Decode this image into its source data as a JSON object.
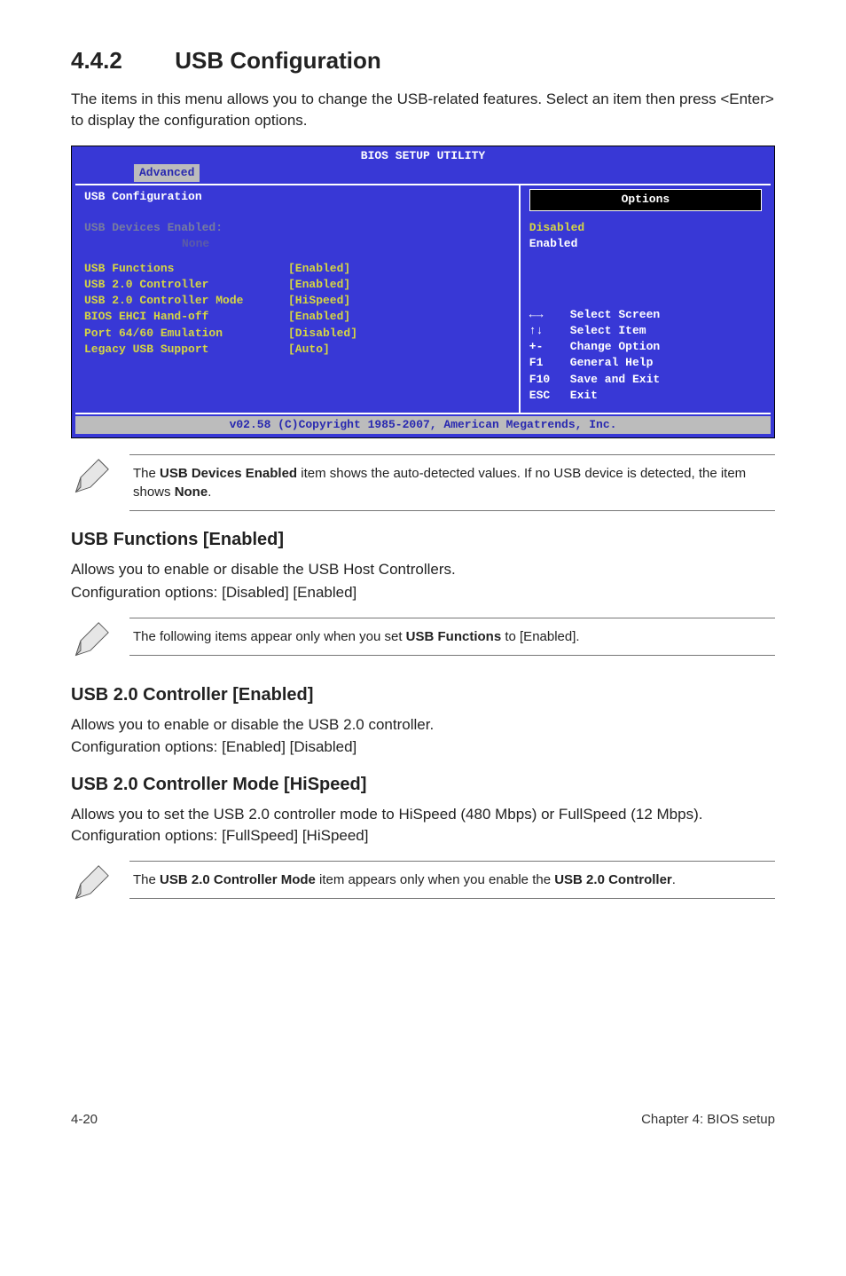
{
  "section": {
    "number": "4.4.2",
    "title": "USB Configuration"
  },
  "intro": "The items in this menu allows you to change the USB-related features. Select an item then press <Enter> to display the configuration options.",
  "bios": {
    "title": "BIOS SETUP UTILITY",
    "tab": "Advanced",
    "panel_title": "USB Configuration",
    "devices_label": "USB Devices Enabled:",
    "devices_value": "None",
    "rows": [
      {
        "label": "USB Functions",
        "value": "[Enabled]"
      },
      {
        "label": "USB 2.0 Controller",
        "value": "[Enabled]"
      },
      {
        "label": "USB 2.0 Controller Mode",
        "value": "[HiSpeed]"
      },
      {
        "label": "BIOS EHCI Hand-off",
        "value": "[Enabled]"
      },
      {
        "label": "Port 64/60 Emulation",
        "value": "[Disabled]"
      },
      {
        "label": "Legacy USB Support",
        "value": "[Auto]"
      }
    ],
    "options_title": "Options",
    "options": {
      "disabled": "Disabled",
      "enabled": "Enabled"
    },
    "help": [
      {
        "sym": "←→",
        "txt": "Select Screen"
      },
      {
        "sym": "↑↓",
        "txt": "Select Item"
      },
      {
        "sym": "+-",
        "txt": "Change Option"
      },
      {
        "sym": "F1",
        "txt": "General Help"
      },
      {
        "sym": "F10",
        "txt": "Save and Exit"
      },
      {
        "sym": "ESC",
        "txt": "Exit"
      }
    ],
    "footer": "v02.58 (C)Copyright 1985-2007, American Megatrends, Inc."
  },
  "note1_a": "The ",
  "note1_b": "USB Devices Enabled",
  "note1_c": " item shows the auto-detected values. If no USB device is detected, the item shows ",
  "note1_d": "None",
  "note1_e": ".",
  "usb_functions": {
    "head": "USB Functions [Enabled]",
    "l1": "Allows you to enable or disable the USB Host Controllers.",
    "l2": "Configuration options: [Disabled] [Enabled]"
  },
  "note2_a": "The following items appear only when you set ",
  "note2_b": "USB Functions",
  "note2_c": " to [Enabled].",
  "usb20ctrl": {
    "head": "USB 2.0 Controller [Enabled]",
    "l1": "Allows you to enable or disable the USB 2.0 controller.",
    "l2": "Configuration options: [Enabled] [Disabled]"
  },
  "usb20mode": {
    "head": "USB 2.0 Controller Mode [HiSpeed]",
    "l1": "Allows you to set the USB 2.0 controller mode to HiSpeed (480 Mbps) or FullSpeed (12 Mbps). Configuration options: [FullSpeed] [HiSpeed]"
  },
  "note3_a": "The ",
  "note3_b": "USB 2.0 Controller Mode",
  "note3_c": " item appears only when you enable the ",
  "note3_d": "USB 2.0 Controller",
  "note3_e": ".",
  "footer": {
    "left": "4-20",
    "right": "Chapter 4: BIOS setup"
  }
}
